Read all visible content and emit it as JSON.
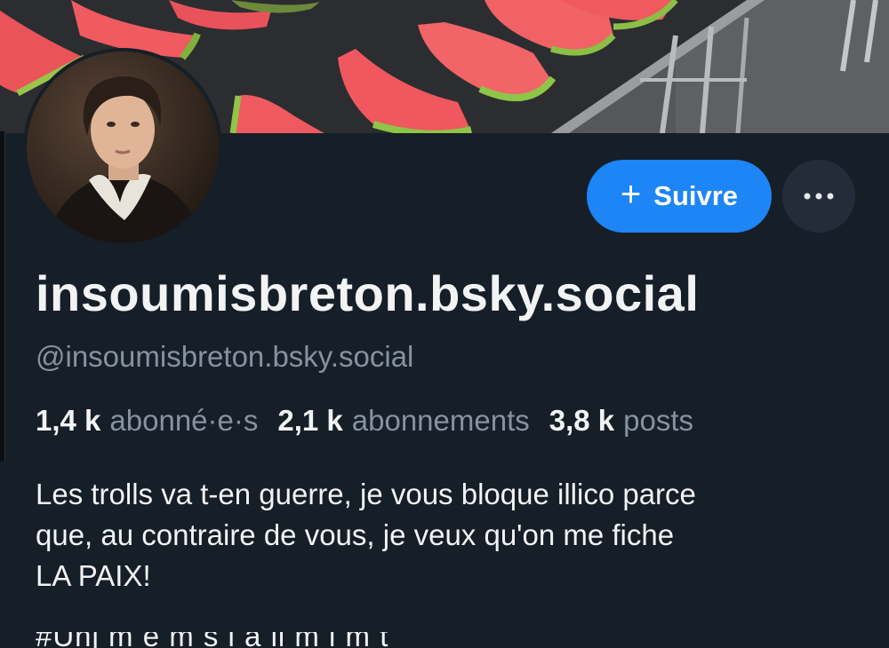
{
  "profile": {
    "display_name": "insoumisbreton.bsky.social",
    "handle": "@insoumisbreton.bsky.social",
    "avatar_icon": "portrait-avatar",
    "banner_icon": "watermelon-banner"
  },
  "actions": {
    "follow_plus": "+",
    "follow_label": "Suivre",
    "more_icon": "ellipsis-icon"
  },
  "stats": {
    "followers_count": "1,4 k",
    "followers_label": "abonné·e·s",
    "following_count": "2,1 k",
    "following_label": "abonnements",
    "posts_count": "3,8 k",
    "posts_label": "posts"
  },
  "bio": {
    "lines": [
      "Les trolls va t-en guerre, je vous bloque illico parce",
      "que, au contraire de vous, je veux qu'on me fiche",
      "LA PAIX!"
    ],
    "partial_line": "#Unj m e m s i à ll m i m t"
  },
  "colors": {
    "background": "#161e27",
    "accent": "#1d85f5",
    "text_primary": "#f1f3f5",
    "text_secondary": "#8692a1",
    "more_button": "#232c38"
  }
}
